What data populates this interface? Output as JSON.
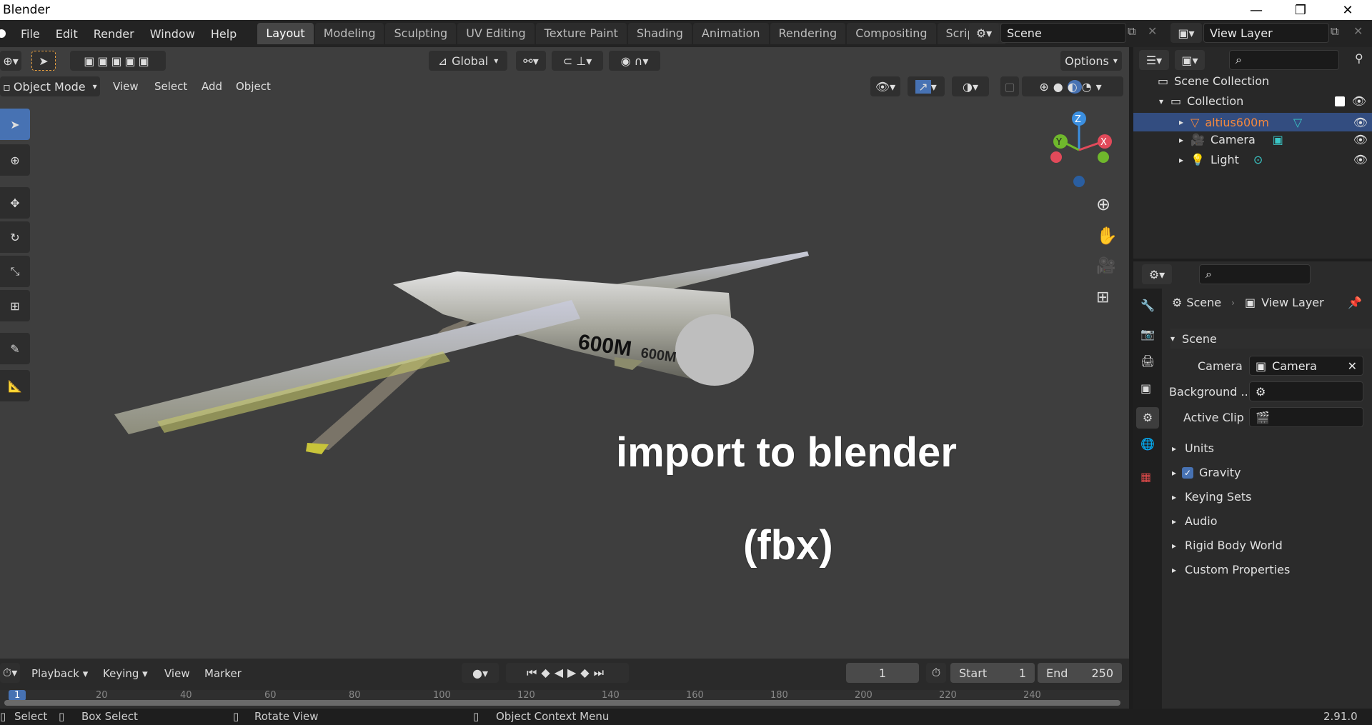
{
  "window": {
    "title": "Blender",
    "minimize": "—",
    "maximize": "❐",
    "close": "✕"
  },
  "menu": [
    "File",
    "Edit",
    "Render",
    "Window",
    "Help"
  ],
  "workspace_tabs": [
    {
      "label": "Layout",
      "active": true
    },
    {
      "label": "Modeling"
    },
    {
      "label": "Sculpting"
    },
    {
      "label": "UV Editing"
    },
    {
      "label": "Texture Paint"
    },
    {
      "label": "Shading"
    },
    {
      "label": "Animation"
    },
    {
      "label": "Rendering"
    },
    {
      "label": "Compositing"
    },
    {
      "label": "Scripting"
    }
  ],
  "add_workspace": "+",
  "scene_field": "Scene",
  "view_layer_field": "View Layer",
  "viewport": {
    "transform_orientation": "Global",
    "options": "Options",
    "mode": "Object Mode",
    "menus": [
      "View",
      "Select",
      "Add",
      "Object"
    ],
    "overlay_line1": "import to blender",
    "overlay_line2": "(fbx)",
    "model_label_big": "600M",
    "model_label_small": "600M",
    "gizmo": {
      "z": "Z",
      "y": "Y",
      "x": "X"
    }
  },
  "outliner": {
    "root": "Scene Collection",
    "collection": "Collection",
    "items": [
      {
        "label": "altius600m",
        "selected": true
      },
      {
        "label": "Camera"
      },
      {
        "label": "Light"
      }
    ]
  },
  "properties": {
    "breadcrumb_scene": "Scene",
    "breadcrumb_view_layer": "View Layer",
    "scene_panel": "Scene",
    "camera_label": "Camera",
    "camera_value": "Camera",
    "background_label": "Background ...",
    "active_clip_label": "Active Clip",
    "panels": [
      "Units",
      "Gravity",
      "Keying Sets",
      "Audio",
      "Rigid Body World",
      "Custom Properties"
    ]
  },
  "timeline": {
    "menus": [
      "Playback",
      "Keying",
      "View",
      "Marker"
    ],
    "current_frame": "1",
    "start_label": "Start",
    "start_value": "1",
    "end_label": "End",
    "end_value": "250",
    "ruler": [
      "20",
      "40",
      "60",
      "80",
      "100",
      "120",
      "140",
      "160",
      "180",
      "200",
      "220",
      "240"
    ],
    "marker": "1"
  },
  "statusbar": {
    "select": "Select",
    "box_select": "Box Select",
    "rotate_view": "Rotate View",
    "context_menu": "Object Context Menu",
    "version": "2.91.0"
  },
  "colors": {
    "accent": "#4772b3",
    "selected_object": "#f5883d",
    "viewport_bg": "#3e3e3e"
  }
}
